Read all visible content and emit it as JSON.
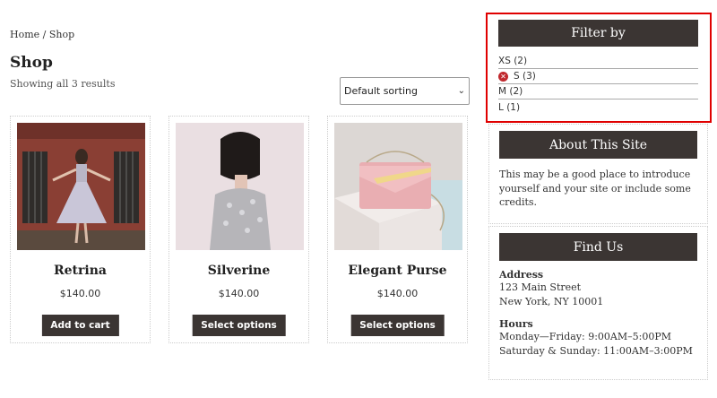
{
  "breadcrumb": {
    "home": "Home",
    "separator": " / ",
    "current": "Shop"
  },
  "page": {
    "title": "Shop",
    "result_count": "Showing all 3 results"
  },
  "sorting": {
    "selected": "Default sorting"
  },
  "products": [
    {
      "name": "Retrina",
      "price": "$140.00",
      "button": "Add to cart"
    },
    {
      "name": "Silverine",
      "price": "$140.00",
      "button": "Select options"
    },
    {
      "name": "Elegant Purse",
      "price": "$140.00",
      "button": "Select options"
    }
  ],
  "filter": {
    "title": "Filter by",
    "items": [
      {
        "label": "XS (2)",
        "active": false
      },
      {
        "label": "S (3)",
        "active": true
      },
      {
        "label": "M (2)",
        "active": false
      },
      {
        "label": "L (1)",
        "active": false
      }
    ]
  },
  "about": {
    "title": "About This Site",
    "text": "This may be a good place to introduce yourself and your site or include some credits."
  },
  "find_us": {
    "title": "Find Us",
    "address_label": "Address",
    "address_line1": "123 Main Street",
    "address_line2": "New York, NY 10001",
    "hours_label": "Hours",
    "hours_line1": "Monday—Friday: 9:00AM–5:00PM",
    "hours_line2": "Saturday & Sunday: 11:00AM–3:00PM"
  },
  "colors": {
    "button_bg": "#3b3533",
    "highlight_border": "#e00000",
    "remove_icon": "#c0282d"
  }
}
